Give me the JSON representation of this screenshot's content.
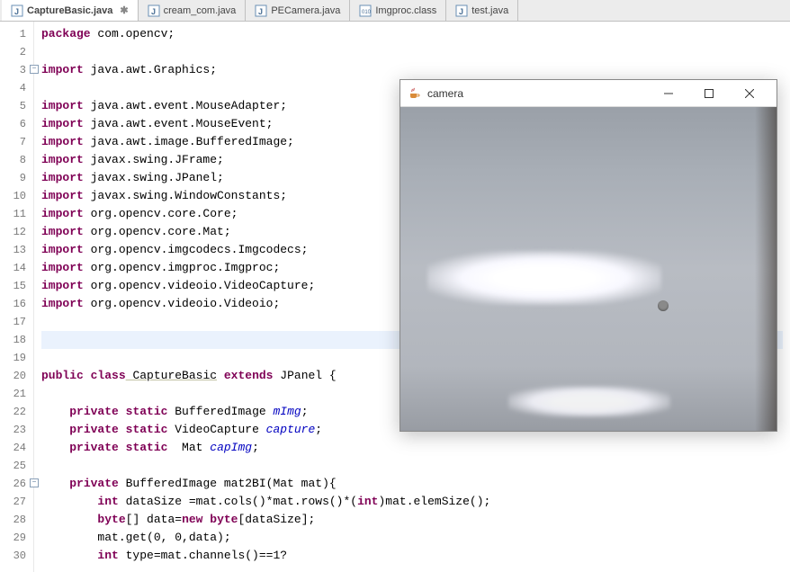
{
  "tabs": [
    {
      "label": "CaptureBasic.java",
      "icon": "J",
      "active": true
    },
    {
      "label": "cream_com.java",
      "icon": "J",
      "active": false
    },
    {
      "label": "PECamera.java",
      "icon": "J",
      "active": false
    },
    {
      "label": "Imgproc.class",
      "icon": "010",
      "active": false
    },
    {
      "label": "test.java",
      "icon": "J",
      "active": false
    }
  ],
  "camera": {
    "title": "camera"
  },
  "code": {
    "lines": [
      {
        "n": 1,
        "tokens": [
          [
            "kw",
            "package"
          ],
          [
            "",
            " com.opencv;"
          ]
        ]
      },
      {
        "n": 2,
        "tokens": []
      },
      {
        "n": 3,
        "fold": true,
        "tokens": [
          [
            "kw",
            "import"
          ],
          [
            "",
            " java.awt.Graphics;"
          ]
        ]
      },
      {
        "n": 4,
        "tokens": []
      },
      {
        "n": 5,
        "tokens": [
          [
            "kw",
            "import"
          ],
          [
            "",
            " java.awt.event.MouseAdapter;"
          ]
        ]
      },
      {
        "n": 6,
        "tokens": [
          [
            "kw",
            "import"
          ],
          [
            "",
            " java.awt.event.MouseEvent;"
          ]
        ]
      },
      {
        "n": 7,
        "tokens": [
          [
            "kw",
            "import"
          ],
          [
            "",
            " java.awt.image.BufferedImage;"
          ]
        ]
      },
      {
        "n": 8,
        "tokens": [
          [
            "kw",
            "import"
          ],
          [
            "",
            " javax.swing.JFrame;"
          ]
        ]
      },
      {
        "n": 9,
        "tokens": [
          [
            "kw",
            "import"
          ],
          [
            "",
            " javax.swing.JPanel;"
          ]
        ]
      },
      {
        "n": 10,
        "tokens": [
          [
            "kw",
            "import"
          ],
          [
            "",
            " javax.swing.WindowConstants;"
          ]
        ]
      },
      {
        "n": 11,
        "tokens": [
          [
            "kw",
            "import"
          ],
          [
            "",
            " org.opencv.core.Core;"
          ]
        ]
      },
      {
        "n": 12,
        "tokens": [
          [
            "kw",
            "import"
          ],
          [
            "",
            " org.opencv.core.Mat;"
          ]
        ]
      },
      {
        "n": 13,
        "tokens": [
          [
            "kw",
            "import"
          ],
          [
            "",
            " org.opencv.imgcodecs.Imgcodecs;"
          ]
        ]
      },
      {
        "n": 14,
        "tokens": [
          [
            "kw",
            "import"
          ],
          [
            "",
            " org.opencv.imgproc.Imgproc;"
          ]
        ]
      },
      {
        "n": 15,
        "tokens": [
          [
            "kw",
            "import"
          ],
          [
            "",
            " org.opencv.videoio.VideoCapture;"
          ]
        ]
      },
      {
        "n": 16,
        "tokens": [
          [
            "kw",
            "import"
          ],
          [
            "",
            " org.opencv.videoio.Videoio;"
          ]
        ]
      },
      {
        "n": 17,
        "tokens": []
      },
      {
        "n": 18,
        "highlight": true,
        "tokens": []
      },
      {
        "n": 19,
        "tokens": []
      },
      {
        "n": 20,
        "tokens": [
          [
            "kw",
            "public"
          ],
          [
            "",
            " "
          ],
          [
            "kw",
            "class"
          ],
          [
            " ",
            ""
          ],
          [
            "underline-class",
            " CaptureBasic"
          ],
          [
            "",
            " "
          ],
          [
            "kw",
            "extends"
          ],
          [
            "",
            " JPanel {"
          ]
        ]
      },
      {
        "n": 21,
        "tokens": []
      },
      {
        "n": 22,
        "tokens": [
          [
            "",
            "    "
          ],
          [
            "kw",
            "private"
          ],
          [
            "",
            " "
          ],
          [
            "kw",
            "static"
          ],
          [
            "",
            " BufferedImage "
          ],
          [
            "field-italic",
            "mImg"
          ],
          [
            "",
            ";"
          ]
        ]
      },
      {
        "n": 23,
        "tokens": [
          [
            "",
            "    "
          ],
          [
            "kw",
            "private"
          ],
          [
            "",
            " "
          ],
          [
            "kw",
            "static"
          ],
          [
            "",
            " VideoCapture "
          ],
          [
            "field-italic",
            "capture"
          ],
          [
            "",
            ";"
          ]
        ]
      },
      {
        "n": 24,
        "tokens": [
          [
            "",
            "    "
          ],
          [
            "kw",
            "private"
          ],
          [
            "",
            " "
          ],
          [
            "kw",
            "static"
          ],
          [
            "",
            "  Mat "
          ],
          [
            "field-italic",
            "capImg"
          ],
          [
            "",
            ";"
          ]
        ]
      },
      {
        "n": 25,
        "tokens": []
      },
      {
        "n": 26,
        "fold": true,
        "tokens": [
          [
            "",
            "    "
          ],
          [
            "kw",
            "private"
          ],
          [
            "",
            " BufferedImage mat2BI(Mat mat){"
          ]
        ]
      },
      {
        "n": 27,
        "tokens": [
          [
            "",
            "        "
          ],
          [
            "kw",
            "int"
          ],
          [
            "",
            " dataSize =mat.cols()*mat.rows()*("
          ],
          [
            "kw",
            "int"
          ],
          [
            "",
            ")mat.elemSize();"
          ]
        ]
      },
      {
        "n": 28,
        "tokens": [
          [
            "",
            "        "
          ],
          [
            "kw",
            "byte"
          ],
          [
            "",
            "[] data="
          ],
          [
            "kw",
            "new"
          ],
          [
            "",
            " "
          ],
          [
            "kw",
            "byte"
          ],
          [
            "",
            "[dataSize];"
          ]
        ]
      },
      {
        "n": 29,
        "tokens": [
          [
            "",
            "        mat.get(0, 0,data);"
          ]
        ]
      },
      {
        "n": 30,
        "tokens": [
          [
            "",
            "        "
          ],
          [
            "kw",
            "int"
          ],
          [
            "",
            " type=mat.channels()==1?"
          ]
        ]
      }
    ]
  }
}
